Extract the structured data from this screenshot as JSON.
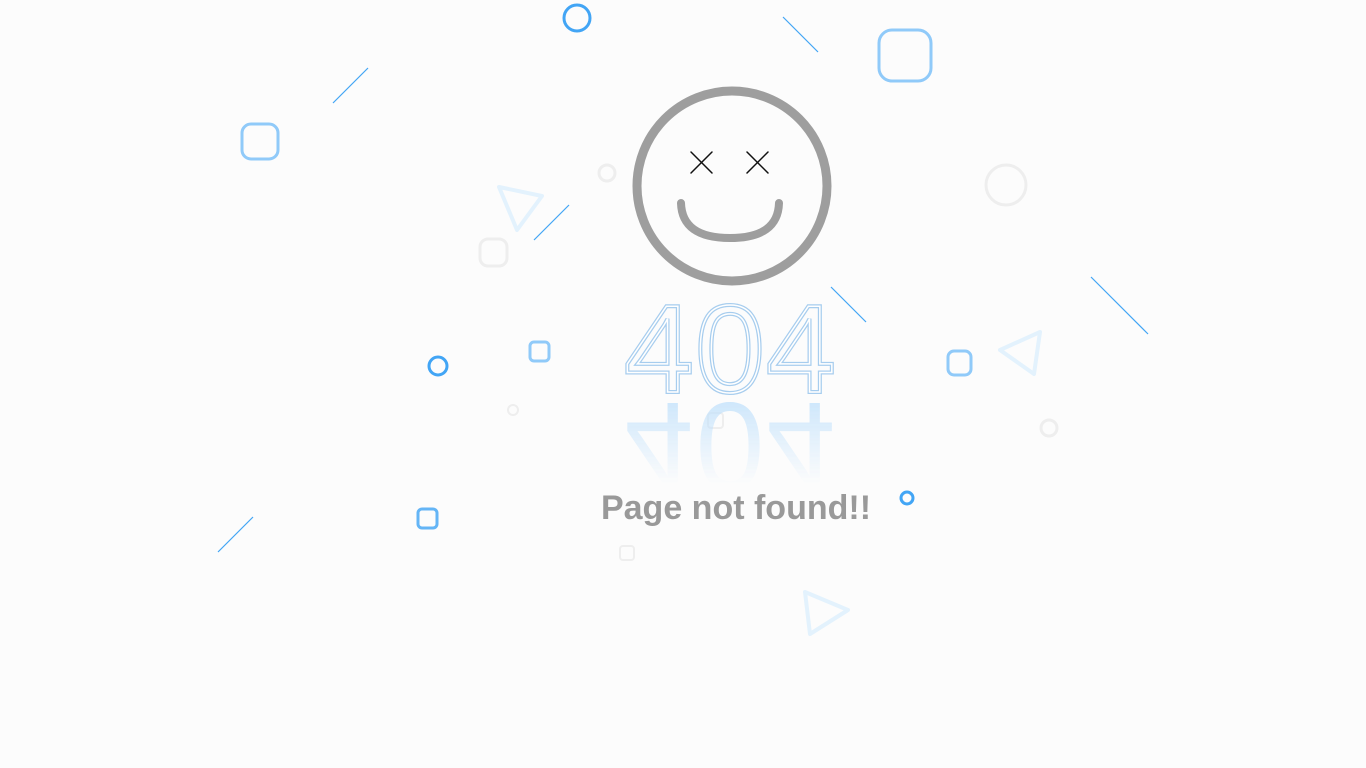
{
  "error": {
    "code": "404",
    "message": "Page not found!!"
  },
  "icons": {
    "face": "dizzy-face-icon"
  },
  "colors": {
    "background": "#fcfcfc",
    "accent_blue": "#42a5f5",
    "light_blue": "#90caf9",
    "pale_blue": "#e3f2fd",
    "face_gray": "#9e9e9e",
    "text_gray": "#999999"
  }
}
